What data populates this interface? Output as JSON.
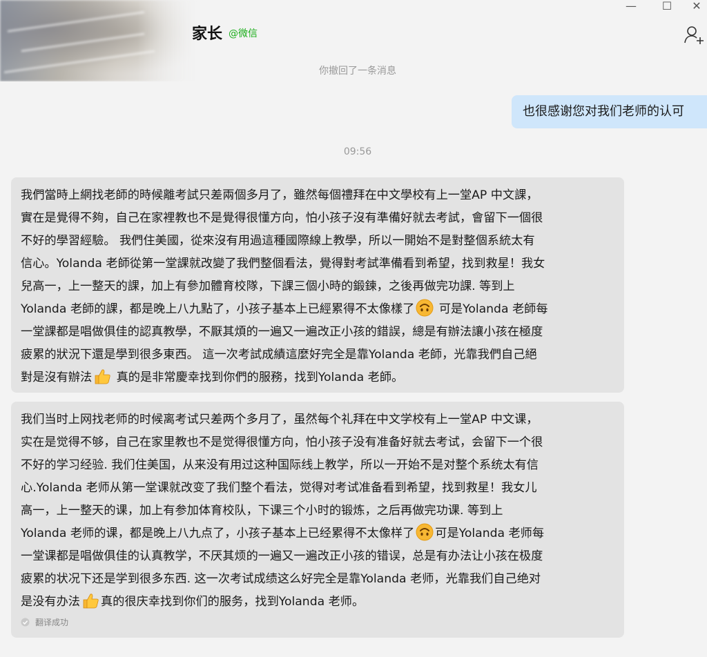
{
  "header": {
    "title": "家长",
    "source": "@微信",
    "window_controls": {
      "minimize": "—",
      "maximize": "☐",
      "close": "✕"
    }
  },
  "conversation": {
    "recall_notice": "你撤回了一条消息",
    "sent_message": "也很感谢您对我们老师的认可",
    "timestamp": "09:56",
    "received_message": {
      "lines": [
        "我們當時上網找老師的時候離考試只差兩個多月了，雖然每個禮拜在中文學校有上一堂AP 中文課，",
        "實在是覺得不夠，自己在家裡教也不是覺得很懂方向，怕小孩子沒有準備好就去考試，會留下一個很",
        "不好的學習經驗。 我們住美國，從來沒有用過這種國際線上教學，所以一開始不是對整個系統太有",
        "信心。Yolanda 老師從第一堂課就改變了我們整個看法，覺得對考試準備看到希望，找到救星！我女",
        "兒高一，上一整天的課，加上有參加體育校隊，下課三個小時的鍛鍊，之後再做完功課. 等到上",
        {
          "before": "Yolanda 老師的課，都是晚上八九點了，小孩子基本上已經累得不太像樣了",
          "emoji": "upside-down-face-emoji",
          "after": " 可是Yolanda 老師每"
        },
        "一堂課都是唱做俱佳的認真教學，不厭其煩的一遍又一遍改正小孩的錯誤，總是有辦法讓小孩在極度",
        "疲累的狀況下還是學到很多東西。 這一次考試成績這麼好完全是靠Yolanda 老師，光靠我們自己絕",
        {
          "before": "對是沒有辦法",
          "emoji": "thumbs-up-emoji",
          "after": " 真的是非常慶幸找到你們的服務，找到Yolanda 老師。"
        }
      ]
    },
    "translated_message": {
      "lines": [
        "我们当时上网找老师的时候离考试只差两个多月了，虽然每个礼拜在中文学校有上一堂AP 中文课，",
        "实在是觉得不够，自己在家里教也不是觉得很懂方向，怕小孩子没有准备好就去考试，会留下一个很",
        "不好的学习经验. 我们住美国，从来没有用过这种国际线上教学，所以一开始不是对整个系统太有信",
        "心.Yolanda 老师从第一堂课就改变了我们整个看法，觉得对考试准备看到希望，找到救星！我女儿",
        "高一，上一整天的课，加上有参加体育校队，下课三个小时的锻炼，之后再做完功课. 等到上",
        {
          "before": "Yolanda 老师的课，都是晚上八九点了，小孩子基本上已经累得不太像样了",
          "emoji": "upside-down-face-emoji",
          "after": "可是Yolanda 老师每"
        },
        "一堂课都是唱做俱佳的认真教学，不厌其烦的一遍又一遍改正小孩的错误，总是有办法让小孩在极度",
        "疲累的状况下还是学到很多东西. 这一次考试成绩这么好完全是靠Yolanda 老师，光靠我们自己绝对",
        {
          "before": "是没有办法",
          "emoji": "thumbs-up-emoji",
          "after": "真的很庆幸找到你们的服务，找到Yolanda 老师。"
        }
      ],
      "status": "翻译成功"
    }
  },
  "colors": {
    "background": "#f3f3f3",
    "sent_bubble": "#cfe6fb",
    "received_bubble": "#e3e3e3",
    "source_tag": "#1aad19"
  }
}
